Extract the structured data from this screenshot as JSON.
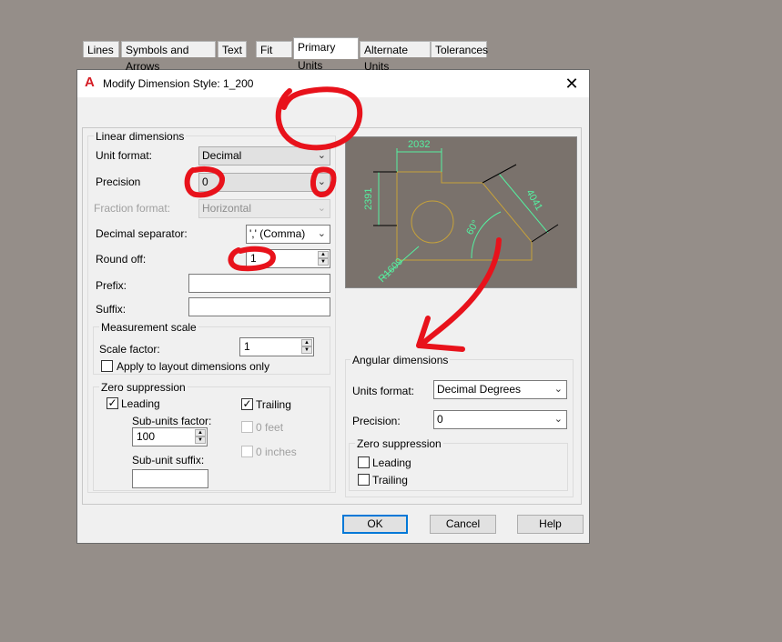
{
  "dialog": {
    "title": "Modify Dimension Style: 1_200",
    "app_icon": "A",
    "close_glyph": "✕"
  },
  "tabs": [
    {
      "label": "Lines"
    },
    {
      "label": "Symbols and Arrows"
    },
    {
      "label": "Text"
    },
    {
      "label": "Fit"
    },
    {
      "label": "Primary Units",
      "active": true
    },
    {
      "label": "Alternate Units"
    },
    {
      "label": "Tolerances"
    }
  ],
  "linear": {
    "group_label": "Linear dimensions",
    "unit_format_label": "Unit format:",
    "unit_format_value": "Decimal",
    "precision_label": "Precision",
    "precision_value": "0",
    "fraction_format_label": "Fraction format:",
    "fraction_format_value": "Horizontal",
    "decimal_sep_label": "Decimal separator:",
    "decimal_sep_value": "','  (Comma)",
    "round_off_label": "Round off:",
    "round_off_value": "1",
    "prefix_label": "Prefix:",
    "prefix_value": "",
    "suffix_label": "Suffix:",
    "suffix_value": ""
  },
  "measurement": {
    "group_label": "Measurement scale",
    "scale_factor_label": "Scale factor:",
    "scale_factor_value": "1",
    "apply_layout_label": "Apply to layout dimensions only",
    "apply_layout_checked": false
  },
  "zero_suppression_linear": {
    "group_label": "Zero suppression",
    "leading_label": "Leading",
    "leading_checked": true,
    "trailing_label": "Trailing",
    "trailing_checked": true,
    "sub_units_factor_label": "Sub-units factor:",
    "sub_units_factor_value": "100",
    "sub_unit_suffix_label": "Sub-unit suffix:",
    "sub_unit_suffix_value": "",
    "feet_label": "0 feet",
    "inches_label": "0 inches"
  },
  "preview": {
    "dim_top": "2032",
    "dim_left": "2391",
    "dim_right": "4041",
    "dim_angle": "60°",
    "dim_radius": "R1609"
  },
  "angular": {
    "group_label": "Angular dimensions",
    "units_format_label": "Units format:",
    "units_format_value": "Decimal Degrees",
    "precision_label": "Precision:",
    "precision_value": "0",
    "zero_group_label": "Zero suppression",
    "leading_label": "Leading",
    "leading_checked": false,
    "trailing_label": "Trailing",
    "trailing_checked": false
  },
  "buttons": {
    "ok": "OK",
    "cancel": "Cancel",
    "help": "Help"
  },
  "colors": {
    "annotation_red": "#e8121b",
    "preview_bg": "#7a726c",
    "dim_green": "#55f0a0",
    "outline_brown": "#b08a2a"
  }
}
